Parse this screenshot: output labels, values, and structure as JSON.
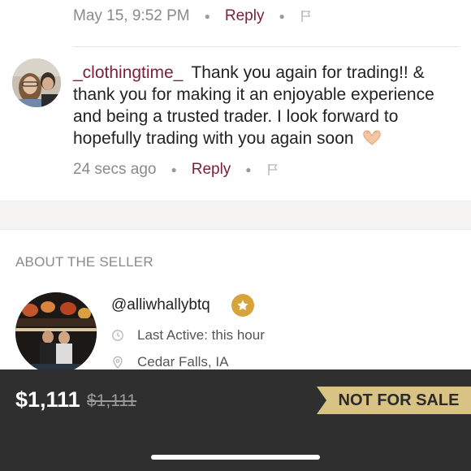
{
  "prev_comment": {
    "timestamp": "May 15, 9:52 PM",
    "reply_label": "Reply",
    "flag_icon": "flag-icon"
  },
  "comment": {
    "username": "_clothingtime_",
    "text": "Thank you again for trading!! & thank you for making it an enjoyable experience and being a trusted trader. I look forward to hopefully trading with you again soon",
    "emoji": "heart-hands",
    "timestamp": "24 secs ago",
    "reply_label": "Reply",
    "flag_icon": "flag-icon"
  },
  "about": {
    "title": "ABOUT THE SELLER",
    "username": "@alliwhallybtq",
    "badge_icon": "star-icon",
    "last_active": "Last Active: this hour",
    "location": "Cedar Falls, IA"
  },
  "listing": {
    "price": "$1,111",
    "original_price": "$1,111",
    "status": "NOT FOR SALE"
  },
  "colors": {
    "accent": "#7b2138",
    "bar": "#2f2f2f",
    "badge": "#d8c384",
    "star": "#d6a43a"
  }
}
